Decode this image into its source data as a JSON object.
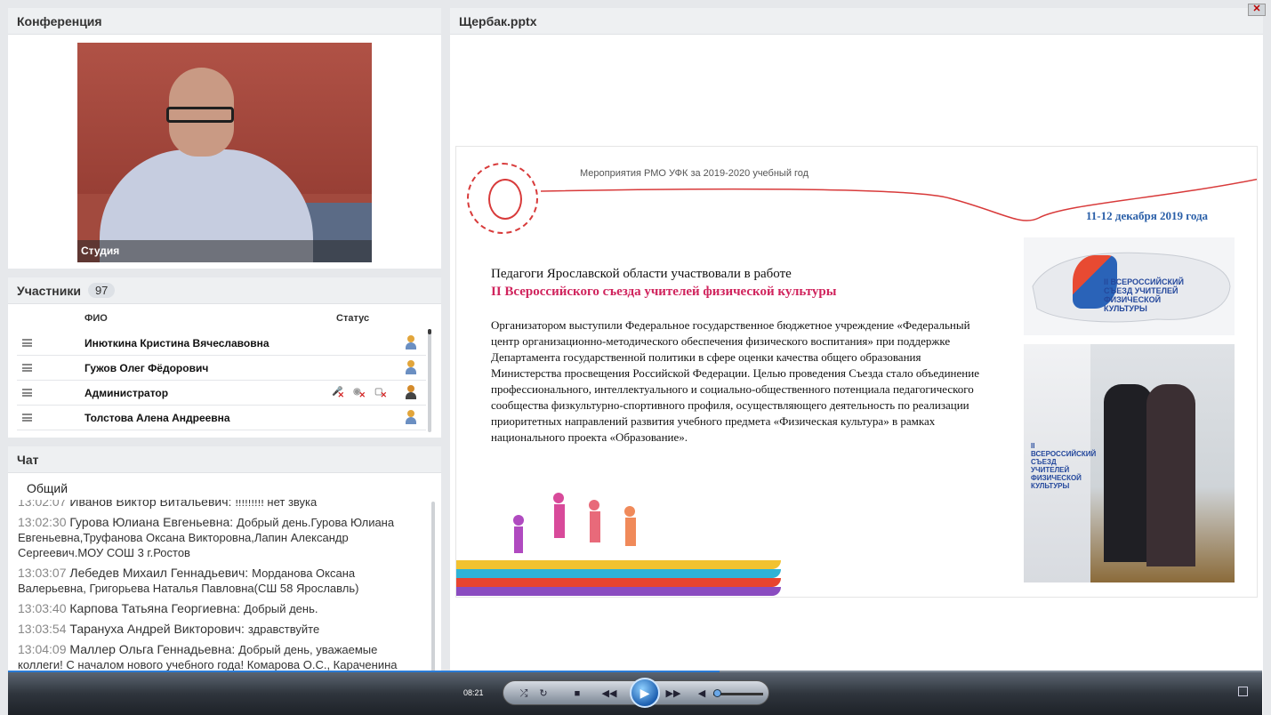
{
  "conference": {
    "title": "Конференция",
    "video_label": "Студия"
  },
  "participants": {
    "title": "Участники",
    "count": "97",
    "col_name": "ФИО",
    "col_status": "Статус",
    "rows": [
      {
        "name": "Инюткина  Кристина Вячеславовна"
      },
      {
        "name": "Гужов Олег  Фёдорович"
      },
      {
        "name": "Администратор"
      },
      {
        "name": "Толстова Алена  Андреевна"
      }
    ]
  },
  "chat": {
    "title": "Чат",
    "tab": "Общий",
    "messages": [
      {
        "time": "13:02:07",
        "name": "Иванов Виктор  Витальевич:",
        "text": "!!!!!!!!! нет звука"
      },
      {
        "time": "13:02:30",
        "name": "Гурова Юлиана  Евгеньевна:",
        "text": "Добрый день.Гурова Юлиана Евгеньевна,Труфанова Оксана Викторовна,Лапин Александр Сергеевич.МОУ СОШ 3 г.Ростов"
      },
      {
        "time": "13:03:07",
        "name": "Лебедев Михаил  Геннадьевич:",
        "text": "Морданова Оксана Валерьевна, Григорьева Наталья Павловна(СШ  58 Ярославль)"
      },
      {
        "time": "13:03:40",
        "name": "Карпова Татьяна Георгиевна:",
        "text": "Добрый день."
      },
      {
        "time": "13:03:54",
        "name": "Тарануха Андрей   Викторович:",
        "text": "здравствуйте"
      },
      {
        "time": "13:04:09",
        "name": "Маллер  Ольга  Геннадьевна:",
        "text": "Добрый день, уважаемые коллеги! С началом нового учебного года! Комарова О.С., Караченина Н.А., Рыбинск"
      }
    ]
  },
  "presentation": {
    "title": "Щербак.pptx",
    "close_label": "✕",
    "slide": {
      "top_text": "Мероприятия РМО УФК за 2019-2020  учебный год",
      "date": "11-12 декабря 2019 года",
      "heading1": "Педагоги Ярославской области участвовали в работе",
      "heading2": "II Всероссийского съезда учителей физической культуры",
      "body": "Организатором выступили  Федеральное государственное бюджетное учреждение «Федеральный центр организационно-методического обеспечения физического воспитания»  при поддержке Департамента  государственной политики  в сфере оценки качества общего образования Министерства  просвещения Российской Федерации. Целью проведения Съезда стало объединение профессионального, интеллектуального и социально-общественного потенциала  педагогического сообщества физкультурно-спортивного профиля,  осуществляющего деятельность по реализации  приоритетных направлений  развития  учебного предмета «Физическая культура»  в рамках национального  проекта «Образование».",
      "congress_logo_text": "II ВСЕРОССИЙСКИЙ СЪЕЗД УЧИТЕЛЕЙ ФИЗИЧЕСКОЙ КУЛЬТУРЫ",
      "banner_text": "II ВСЕРОССИЙСКИЙ СЪЕЗД УЧИТЕЛЕЙ ФИЗИЧЕСКОЙ КУЛЬТУРЫ"
    }
  },
  "player": {
    "time": "08:21"
  },
  "colors": {
    "accent_blue": "#2a5fa8",
    "heading_pink": "#d0245d"
  }
}
